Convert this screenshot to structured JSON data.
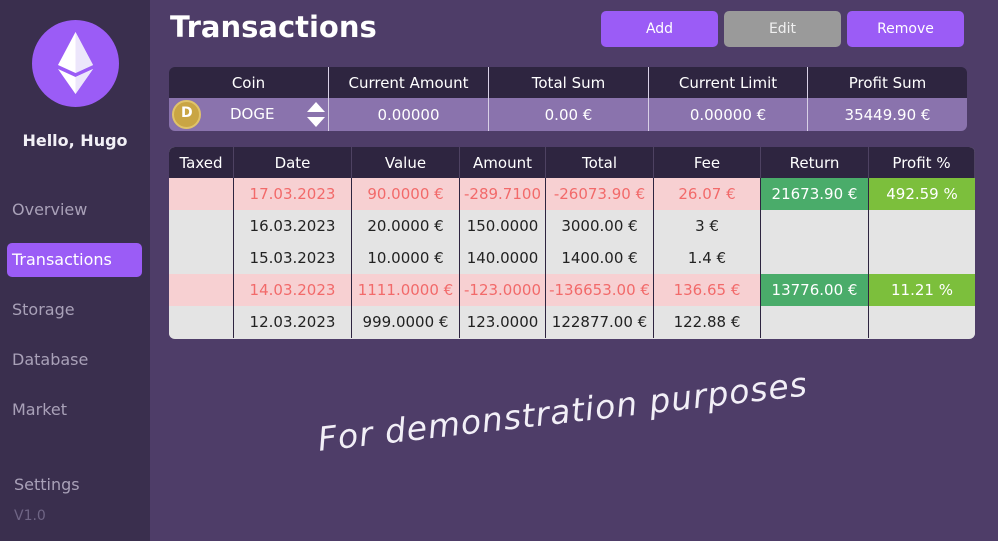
{
  "user": {
    "greeting": "Hello, Hugo"
  },
  "nav": {
    "items": [
      {
        "label": "Overview"
      },
      {
        "label": "Transactions"
      },
      {
        "label": "Storage"
      },
      {
        "label": "Database"
      },
      {
        "label": "Market"
      }
    ],
    "settings": "Settings",
    "version": "V1.0"
  },
  "header": {
    "title": "Transactions",
    "add_label": "Add",
    "edit_label": "Edit",
    "remove_label": "Remove"
  },
  "coin_table": {
    "headers": [
      "Coin",
      "Current Amount",
      "Total Sum",
      "Current Limit",
      "Profit Sum"
    ],
    "row": {
      "coin": "DOGE",
      "coin_icon": "doge-icon",
      "current_amount": "0.00000",
      "total_sum": "0.00 €",
      "current_limit": "0.00000 €",
      "profit_sum": "35449.90 €"
    }
  },
  "tx_table": {
    "headers": [
      "Taxed",
      "Date",
      "Value",
      "Amount",
      "Total",
      "Fee",
      "Return",
      "Profit %"
    ],
    "rows": [
      {
        "type": "loss",
        "taxed": "",
        "date": "17.03.2023",
        "value": "90.0000 €",
        "amount": "-289.7100",
        "total": "-26073.90 €",
        "fee": "26.07 €",
        "return": "21673.90 €",
        "profit": "492.59 %"
      },
      {
        "type": "plain",
        "taxed": "",
        "date": "16.03.2023",
        "value": "20.0000 €",
        "amount": "150.0000",
        "total": "3000.00 €",
        "fee": "3 €",
        "return": "",
        "profit": ""
      },
      {
        "type": "plain",
        "taxed": "",
        "date": "15.03.2023",
        "value": "10.0000 €",
        "amount": "140.0000",
        "total": "1400.00 €",
        "fee": "1.4 €",
        "return": "",
        "profit": ""
      },
      {
        "type": "loss",
        "taxed": "",
        "date": "14.03.2023",
        "value": "1111.0000 €",
        "amount": "-123.0000",
        "total": "-136653.00 €",
        "fee": "136.65 €",
        "return": "13776.00 €",
        "profit": "11.21 %"
      },
      {
        "type": "plain",
        "taxed": "",
        "date": "12.03.2023",
        "value": "999.0000 €",
        "amount": "123.0000",
        "total": "122877.00 €",
        "fee": "122.88 €",
        "return": "",
        "profit": ""
      }
    ]
  },
  "watermark": "For demonstration purposes",
  "colors": {
    "accent": "#9b5cf6",
    "background": "#4e3d68",
    "sidebar": "#3a2f4e",
    "loss_row": "#f7d0d2",
    "loss_text": "#f26a6a",
    "return_green": "#4aac6a",
    "profit_green": "#7cbf3c"
  }
}
